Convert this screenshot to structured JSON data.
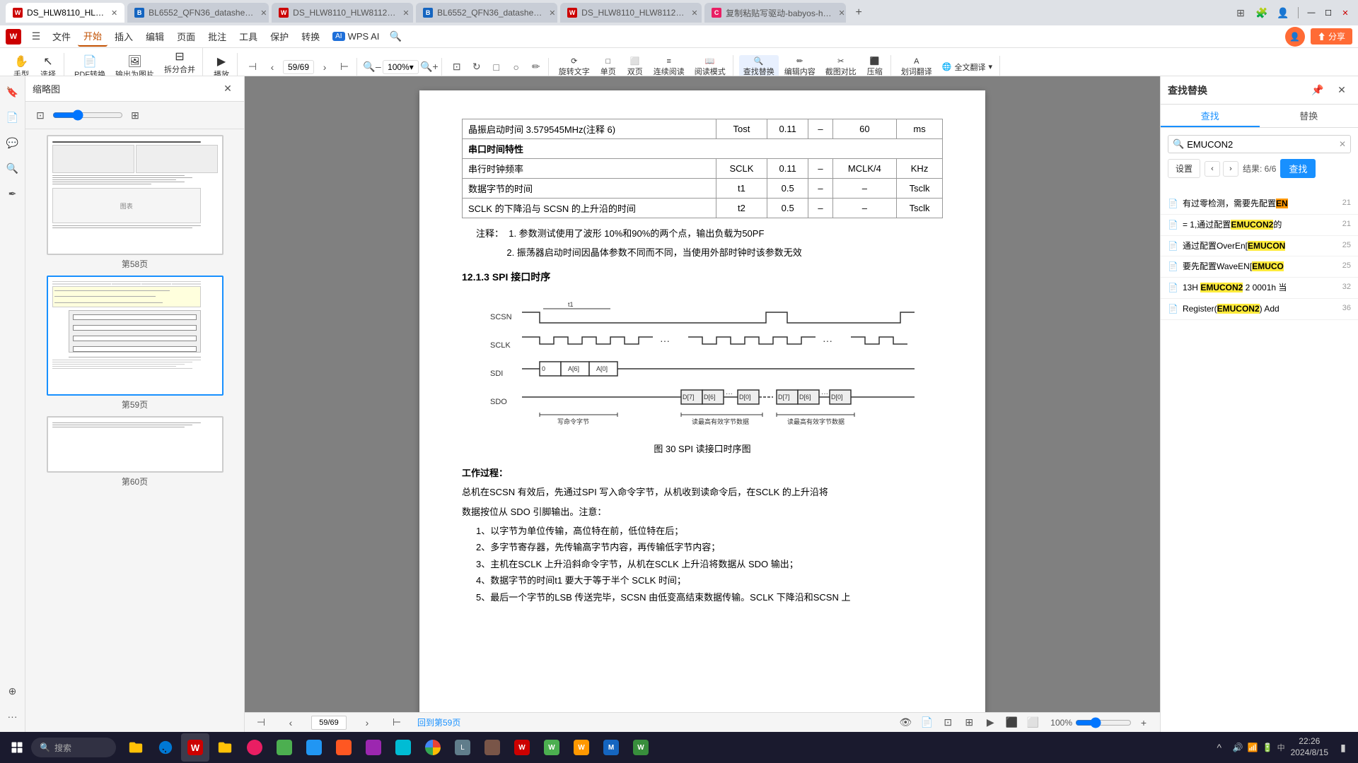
{
  "browser": {
    "tabs": [
      {
        "id": "t1",
        "label": "DS_HLW8110_HL…",
        "active": true,
        "color": "#c00"
      },
      {
        "id": "t2",
        "label": "BL6552_QFN36_datashe…",
        "active": false,
        "color": "#1565c0"
      },
      {
        "id": "t3",
        "label": "DS_HLW8110_HLW8112…",
        "active": false,
        "color": "#c00"
      },
      {
        "id": "t4",
        "label": "BL6552_QFN36_datashe…",
        "active": false,
        "color": "#1565c0"
      },
      {
        "id": "t5",
        "label": "DS_HLW8110_HLW8112…",
        "active": false,
        "color": "#c00"
      },
      {
        "id": "t6",
        "label": "复制粘贴写驱动-babyos-h…",
        "active": false,
        "color": "#e91e63"
      }
    ],
    "window_controls": [
      "–",
      "□",
      "✕"
    ]
  },
  "toolbar": {
    "logo": "W",
    "menus": [
      {
        "id": "file",
        "label": "文件"
      },
      {
        "id": "home",
        "label": "开始",
        "active": true
      },
      {
        "id": "insert",
        "label": "插入"
      },
      {
        "id": "edit",
        "label": "编辑"
      },
      {
        "id": "page",
        "label": "页面"
      },
      {
        "id": "review",
        "label": "批注"
      },
      {
        "id": "tools",
        "label": "工具"
      },
      {
        "id": "protect",
        "label": "保护"
      },
      {
        "id": "convert",
        "label": "转换"
      },
      {
        "id": "wpsai",
        "label": "WPS AI"
      },
      {
        "id": "search",
        "label": "🔍"
      }
    ],
    "zoom": "100%",
    "page_nav": "59/69",
    "buttons": {
      "hand_tool": "手型",
      "select": "选择",
      "pdf_convert": "PDF转换",
      "output_img": "输出为图片",
      "split_merge": "拆分合并",
      "play": "播放",
      "rotate_text": "旋转文字",
      "single_page": "单页",
      "double_page": "双页",
      "continuous": "连续阅读",
      "read_mode": "阅读模式",
      "find_replace": "查找替换",
      "edit_content": "编辑内容",
      "screenshot": "截图对比",
      "compress": "压缩",
      "word_translate": "划词翻译",
      "full_translate": "全文翻译"
    }
  },
  "sidebar": {
    "title": "缩略图",
    "pages": [
      {
        "label": "第58页",
        "num": 58
      },
      {
        "label": "第59页",
        "num": 59,
        "active": true
      },
      {
        "label": "第60页",
        "num": 60
      }
    ]
  },
  "document": {
    "page_number": "59/69",
    "sections": {
      "table_title": "串口时序特性",
      "table_rows": [
        {
          "param": "晶振启动时间 3.579545MHz(注释 6)",
          "symbol": "Tost",
          "min": "0.11",
          "typ": "–",
          "max": "60",
          "unit": "ms"
        },
        {
          "param": "串口时序特性",
          "colspan": true
        },
        {
          "param": "串行时钟频率",
          "symbol": "SCLK",
          "min": "0.11",
          "typ": "–",
          "max": "MCLK/4",
          "unit": "KHz"
        },
        {
          "param": "数据字节的时间",
          "symbol": "t1",
          "min": "0.5",
          "typ": "–",
          "max": "–",
          "unit": "Tsclk"
        },
        {
          "param": "SCLK 的下降沿与 SCSN 的上升沿的时间",
          "symbol": "t2",
          "min": "0.5",
          "typ": "–",
          "max": "–",
          "unit": "Tsclk"
        }
      ],
      "notes": [
        "参数测试使用了波形 10%和90%的两个点，输出负载为50PF",
        "振荡器启动时间因晶体参数不同而不同，当使用外部时钟时该参数无效"
      ],
      "section_title": "12.1.3  SPI 接口时序",
      "diagram_caption": "图 30 SPI 读接口时序图",
      "work_title": "工作过程：",
      "work_desc": "总机在SCSN 有效后，先通过SPI 写入命令字节，从机收到读命令后，在SCLK 的上升沿将\n数据按位从 SDO 引脚输出。注意：",
      "work_items": [
        "以字节为单位传输，高位特在前，低位特在后；",
        "多字节寄存器，先传输高字节内容，再传输低字节内容；",
        "主机在SCLK 上升沿打命令字节，从机在SCLK 上升沿将数据从 SDO 输出；",
        "数据字节的时间t1 要大于等于半个 SCLK 时间；",
        "最后一个字节的LSB 传送完母，SCSN 由低变高结束数据传输。SCLK 下降沿和SCSN 上"
      ]
    }
  },
  "find_replace": {
    "title": "查找替换",
    "tabs": [
      "查找",
      "替换"
    ],
    "active_tab": 0,
    "search_text": "EMUCON2",
    "find_btn": "查找",
    "settings_btn": "设置",
    "result_count": "结果: 6/6",
    "results": [
      {
        "text_before": "有过零检测，需要先配置",
        "highlight": "EN",
        "text_after": "",
        "page": "21"
      },
      {
        "text_before": "= 1,通过配置",
        "highlight": "EMUCON2",
        "text_after": "的",
        "page": "21"
      },
      {
        "text_before": "通过配置OverEn[",
        "highlight": "EMUCON",
        "text_after": "",
        "page": "25"
      },
      {
        "text_before": "要先配置WaveEN[",
        "highlight": "EMUCO",
        "text_after": "",
        "page": "25"
      },
      {
        "text_before": "13H ",
        "highlight": "EMUCON2",
        "text_after": " 2 0001h 当",
        "page": "32"
      },
      {
        "text_before": "Register(",
        "highlight": "EMUCON2",
        "text_after": ") Add",
        "page": "36"
      }
    ]
  },
  "status_bar": {
    "page_nav": "59/69",
    "back_label": "回到第59页",
    "zoom": "100%",
    "icons": [
      "view1",
      "view2",
      "view3",
      "view4",
      "play"
    ]
  },
  "taskbar": {
    "time": "22:26",
    "date": "2024/8/15",
    "search_placeholder": "搜索"
  }
}
